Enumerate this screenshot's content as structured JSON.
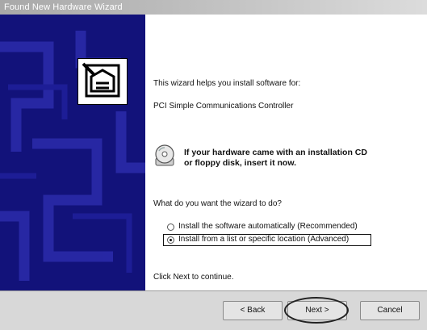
{
  "window": {
    "title": "Found New Hardware Wizard"
  },
  "content": {
    "intro": "This wizard helps you install software for:",
    "device_name": "PCI Simple Communications Controller",
    "cd_line1": "If your hardware came with an installation CD",
    "cd_line2": "or floppy disk, insert it now.",
    "question": "What do you want the wizard to do?",
    "options": [
      {
        "label": "Install the software automatically (Recommended)",
        "selected": false
      },
      {
        "label": "Install from a list or specific location (Advanced)",
        "selected": true
      }
    ],
    "continue_hint": "Click Next to continue."
  },
  "buttons": {
    "back": "< Back",
    "next": "Next >",
    "cancel": "Cancel"
  },
  "colors": {
    "left_panel": "#12127a",
    "footer": "#d8d8d8"
  },
  "icons": {
    "wizard": "hardware-wizard-icon",
    "cd": "cd-disk-icon"
  }
}
